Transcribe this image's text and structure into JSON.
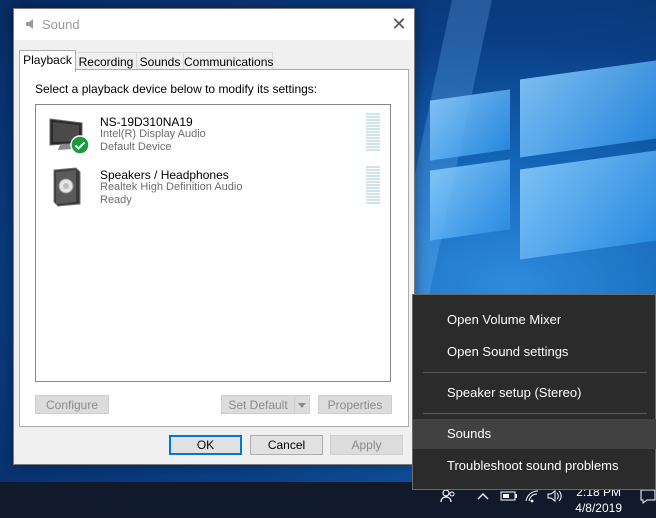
{
  "dialog": {
    "title": "Sound",
    "close_glyph": "✕",
    "tabs": [
      {
        "label": "Playback",
        "active": true
      },
      {
        "label": "Recording",
        "active": false
      },
      {
        "label": "Sounds",
        "active": false
      },
      {
        "label": "Communications",
        "active": false
      }
    ],
    "instruction": "Select a playback device below to modify its settings:",
    "devices": [
      {
        "name": "NS-19D310NA19",
        "driver": "Intel(R) Display Audio",
        "status": "Default Device",
        "icon": "monitor-icon",
        "badge": "default-check-icon"
      },
      {
        "name": "Speakers / Headphones",
        "driver": "Realtek High Definition Audio",
        "status": "Ready",
        "icon": "speaker-icon"
      }
    ],
    "buttons": {
      "configure": "Configure",
      "set_default": "Set Default",
      "properties": "Properties",
      "ok": "OK",
      "cancel": "Cancel",
      "apply": "Apply"
    }
  },
  "context_menu": {
    "items": [
      {
        "label": "Open Volume Mixer"
      },
      {
        "label": "Open Sound settings"
      },
      {
        "label": "Speaker setup (Stereo)"
      },
      {
        "label": "Sounds",
        "highlighted": true
      },
      {
        "label": "Troubleshoot sound problems"
      }
    ]
  },
  "taskbar": {
    "clock_time": "2:18 PM",
    "clock_date": "4/8/2019"
  },
  "colors": {
    "accent": "#0078d7",
    "check_green": "#1a9c3e",
    "menu_bg": "#2b2b2b"
  }
}
